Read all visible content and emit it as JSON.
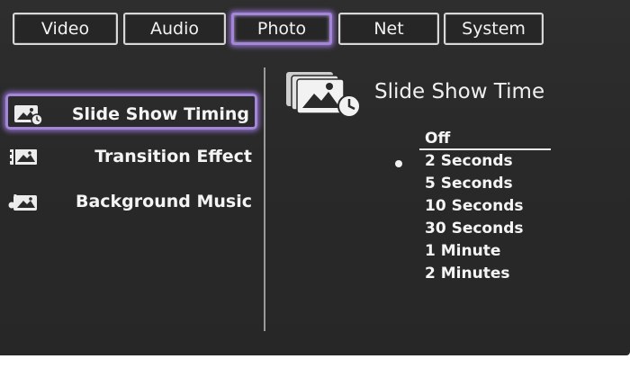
{
  "tabs": [
    {
      "label": "Video"
    },
    {
      "label": "Audio"
    },
    {
      "label": "Photo"
    },
    {
      "label": "Net"
    },
    {
      "label": "System"
    }
  ],
  "active_tab": "Photo",
  "menu": {
    "items": [
      {
        "label": "Slide Show Timing",
        "icon": "slideshow-timer-icon"
      },
      {
        "label": "Transition Effect",
        "icon": "transition-effect-icon"
      },
      {
        "label": "Background Music",
        "icon": "background-music-icon"
      }
    ],
    "active_item": "Slide Show Timing"
  },
  "panel": {
    "title": "Slide Show Time",
    "icon": "slideshow-timer-icon",
    "options": [
      {
        "label": "Off"
      },
      {
        "label": "2 Seconds"
      },
      {
        "label": "5 Seconds"
      },
      {
        "label": "10 Seconds"
      },
      {
        "label": "30 Seconds"
      },
      {
        "label": "1 Minute"
      },
      {
        "label": "2 Minutes"
      }
    ],
    "highlighted_option": "Off",
    "selected_option": "2 Seconds"
  },
  "colors": {
    "background": "#2a2a2a",
    "accent": "#a486d8",
    "text": "#f4f4f4",
    "divider": "#9a9a9a"
  }
}
